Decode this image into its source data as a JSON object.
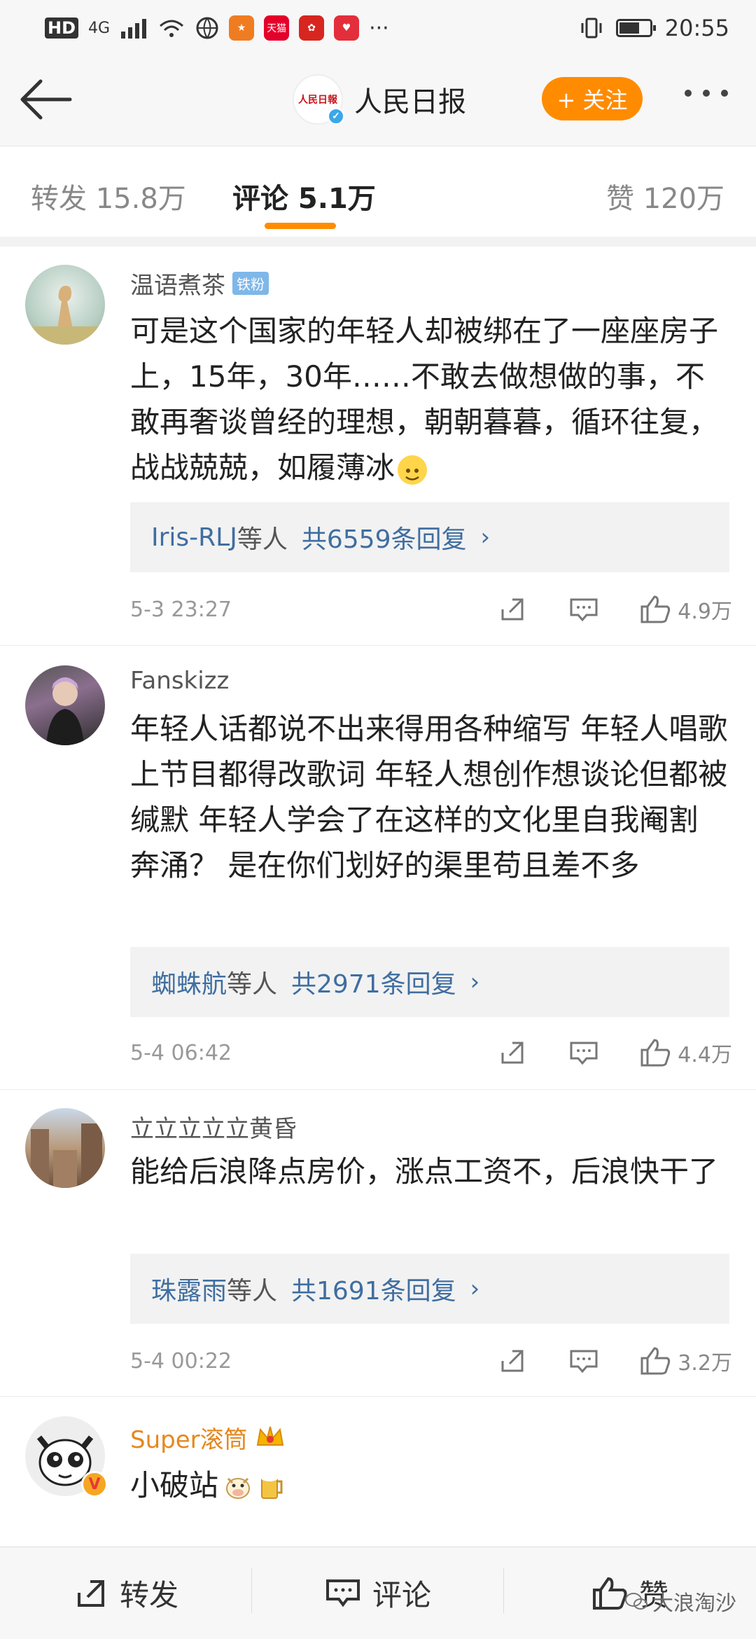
{
  "status_bar": {
    "network": "4G",
    "time": "20:55",
    "battery_level": 0.65,
    "app_icons": [
      "tmall-icon",
      "huawei-icon",
      "app-icon"
    ],
    "apps_more": "···"
  },
  "header": {
    "account_name": "人民日报",
    "follow_label": "+ 关注"
  },
  "tabs": [
    {
      "label": "转发 15.8万"
    },
    {
      "label": "评论 5.1万"
    },
    {
      "label": "赞 120万"
    }
  ],
  "comments": [
    {
      "user": "温语煮茶",
      "badge": "铁粉",
      "text": "可是这个国家的年轻人却被绑在了一座座房子上，15年，30年……不敢去做想做的事，不敢再奢谈曾经的理想，朝朝暮暮，循环往复，战战兢兢，如履薄冰",
      "reply_users": "Iris-RLJ",
      "reply_mid": "等人",
      "reply_count": "共6559条回复",
      "time": "5-3 23:27",
      "likes": "4.9万"
    },
    {
      "user": "Fanskizz",
      "text": "年轻人话都说不出来得用各种缩写  年轻人唱歌上节目都得改歌词 年轻人想创作想谈论但都被缄默  年轻人学会了在这样的文化里自我阉割  奔涌？ 是在你们划好的渠里苟且差不多",
      "reply_users": "蜘蛛航",
      "reply_mid": "等人",
      "reply_count": "共2971条回复",
      "time": "5-4 06:42",
      "likes": "4.4万"
    },
    {
      "user": "立立立立立黄昏",
      "text": "能给后浪降点房价，涨点工资不，后浪快干了",
      "reply_users": "珠露雨",
      "reply_mid": "等人",
      "reply_count": "共1691条回复",
      "time": "5-4 00:22",
      "likes": "3.2万"
    },
    {
      "user": "Super滚筒",
      "text": "小破站"
    }
  ],
  "bottom_bar": {
    "repost": "转发",
    "comment": "评论",
    "like": "赞"
  },
  "watermark": "大浪淘沙"
}
